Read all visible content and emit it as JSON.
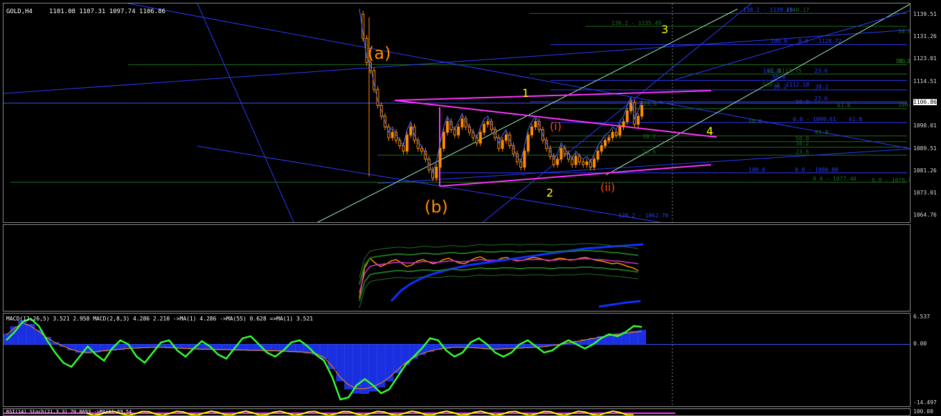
{
  "chart_data": [
    {
      "type": "line",
      "title": "GOLD,H4",
      "ohlc_header": "1101.08 1107.31 1097.74 1106.86",
      "ylim": [
        1062,
        1144
      ],
      "y_ticks": [
        "1139.51",
        "1131.26",
        "1123.01",
        "1114.51",
        "1106.86",
        "1098.01",
        "1089.51",
        "1081.26",
        "1073.01",
        "1064.76"
      ],
      "current_price": "1106.86",
      "colors": {
        "background": "#000000",
        "up_candle": "#ff8c00",
        "fib_green": "#1f6f1f",
        "fib_blue": "#2a3cff",
        "triangle": "#ff33ff",
        "channel": "#9ff0c0",
        "wave_major": "#ffff00",
        "wave_corrective": "#ff8c00",
        "wave_minor": "#ff4500"
      },
      "price_series": [
        1140,
        1131,
        1122,
        1119,
        1112,
        1106,
        1102,
        1098,
        1094,
        1096,
        1093,
        1091,
        1089,
        1095,
        1098,
        1093,
        1090,
        1089,
        1086,
        1082,
        1079,
        1083,
        1090,
        1096,
        1100,
        1097,
        1095,
        1098,
        1101,
        1098,
        1096,
        1094,
        1092,
        1096,
        1099,
        1100,
        1097,
        1094,
        1090,
        1093,
        1095,
        1091,
        1088,
        1085,
        1083,
        1089,
        1095,
        1098,
        1100,
        1097,
        1093,
        1090,
        1087,
        1084,
        1086,
        1090,
        1088,
        1086,
        1084,
        1087,
        1085,
        1084,
        1085,
        1083,
        1086,
        1089,
        1091,
        1093,
        1094,
        1096,
        1095,
        1098,
        1100,
        1104,
        1107,
        1099,
        1102,
        1106
      ],
      "wave_labels": [
        {
          "text": "(a)",
          "role": "corrective"
        },
        {
          "text": "(b)",
          "role": "corrective"
        },
        {
          "text": "1",
          "role": "major"
        },
        {
          "text": "2",
          "role": "major"
        },
        {
          "text": "3",
          "role": "major"
        },
        {
          "text": "4",
          "role": "major"
        },
        {
          "text": "(i)",
          "role": "minor"
        },
        {
          "text": "(ii)",
          "role": "minor"
        }
      ],
      "fib_labels": [
        {
          "text": "138.2 - 1139.49",
          "color": "#2a3cff",
          "price": 1140.3
        },
        {
          "text": "1140.17",
          "color": "#1f6f1f",
          "price": 1140.3
        },
        {
          "text": "138.2 - 1135.49",
          "color": "#1f6f1f",
          "price": 1135.5
        },
        {
          "text": "50.0",
          "color": "#1f6f1f",
          "price": 1132.5
        },
        {
          "text": "100.0",
          "color": "#2a3cff",
          "price": 1128.7
        },
        {
          "text": "0.0 - 1128.72",
          "color": "#2a3cff",
          "price": 1128.7
        },
        {
          "text": "100.0",
          "color": "#1f6f1f",
          "price": 1121.2
        },
        {
          "text": "38.2",
          "color": "#1f6f1f",
          "price": 1121.2
        },
        {
          "text": "161.8",
          "color": "#2a3cff",
          "price": 1117.7
        },
        {
          "text": "61.8",
          "color": "#1f6f1f",
          "price": 1117.7
        },
        {
          "text": "1117.75",
          "color": "#1f6f1f",
          "price": 1117.7
        },
        {
          "text": "23.6",
          "color": "#2a3cff",
          "price": 1117.7
        },
        {
          "text": "50.0",
          "color": "#2a3cff",
          "price": 1115.3
        },
        {
          "text": "138.2",
          "color": "#1f6f1f",
          "price": 1112.6
        },
        {
          "text": "1112.18",
          "color": "#2a3cff",
          "price": 1112.6
        },
        {
          "text": "38.2",
          "color": "#2a3cff",
          "price": 1111.8
        },
        {
          "text": "38.2",
          "color": "#2a3cff",
          "price": 1111.8
        },
        {
          "text": "23.6",
          "color": "#2a3cff",
          "price": 1107.4
        },
        {
          "text": "50.0",
          "color": "#2a3cff",
          "price": 1106.2
        },
        {
          "text": "61.8",
          "color": "#1f6f1f",
          "price": 1104.8
        },
        {
          "text": "100.0",
          "color": "#1f6f1f",
          "price": 1105.0
        },
        {
          "text": "23.6",
          "color": "#1f6f1f",
          "price": 1105.3
        },
        {
          "text": "0.0 - 1099.61",
          "color": "#2a3cff",
          "price": 1099.6
        },
        {
          "text": "61.8",
          "color": "#2a3cff",
          "price": 1099.6
        },
        {
          "text": "50.0",
          "color": "#1f6f1f",
          "price": 1098.9
        },
        {
          "text": "61.8",
          "color": "#1f6f1f",
          "price": 1094.7
        },
        {
          "text": "38.2",
          "color": "#1f6f1f",
          "price": 1093.2
        },
        {
          "text": "50.0",
          "color": "#1f6f1f",
          "price": 1092.5
        },
        {
          "text": "38.2",
          "color": "#1f6f1f",
          "price": 1090.5
        },
        {
          "text": "23.6",
          "color": "#1f6f1f",
          "price": 1087.5
        },
        {
          "text": "23.6",
          "color": "#1f6f1f",
          "price": 1087.5
        },
        {
          "text": "0.0 - 1080.88",
          "color": "#2a3cff",
          "price": 1080.9
        },
        {
          "text": "100.0",
          "color": "#2a3cff",
          "price": 1080.9
        },
        {
          "text": "0.0 - 1077.40",
          "color": "#1f6f1f",
          "price": 1077.4
        },
        {
          "text": "0.0 - 1076.88",
          "color": "#1f6f1f",
          "price": 1076.9
        },
        {
          "text": "138.2 - 1062.70",
          "color": "#2a3cff",
          "price": 1063.8
        }
      ]
    },
    {
      "type": "line",
      "title": "",
      "series": [
        {
          "values": [
            106,
            62,
            48,
            55,
            60,
            57,
            52,
            50,
            55,
            60,
            58,
            52,
            50,
            53,
            56,
            54,
            50,
            48,
            52,
            55,
            56,
            52,
            48,
            46,
            50,
            54,
            52,
            48,
            47,
            50,
            52,
            51,
            49,
            47,
            48,
            50,
            52,
            50,
            48,
            49,
            51,
            50,
            48,
            47,
            49,
            51,
            52,
            54,
            56,
            55,
            57,
            60,
            62,
            66
          ]
        },
        {
          "values": [
            98,
            70,
            60,
            58,
            57,
            56,
            55,
            54,
            54,
            55,
            55,
            54,
            53,
            53,
            54,
            54,
            53,
            52,
            52,
            53,
            53,
            52,
            51,
            50,
            51,
            51,
            51,
            50,
            50,
            50,
            51,
            51,
            50,
            50,
            50,
            50,
            51,
            51,
            50,
            50,
            50,
            50,
            49,
            49,
            49,
            50,
            50,
            51,
            52,
            52,
            53,
            54,
            55,
            56
          ]
        },
        {
          "values": [
            110,
            95,
            85,
            78,
            72,
            68,
            64,
            61,
            58,
            56,
            54,
            52,
            50,
            48,
            46,
            44,
            42,
            40,
            38,
            36,
            34,
            33,
            32,
            31,
            30,
            29,
            28
          ]
        },
        {
          "values": [
            118,
            115,
            112,
            110
          ]
        }
      ]
    },
    {
      "type": "line",
      "header": "MACD(12,26,5) 3.521 2.958  MACD(2,8,3) 4.286 2.210  ->MA(1) 4.286  ->MA(55) 0.628  =>MA(1) 3.521",
      "y_ticks": [
        "6.537",
        "0.00",
        "-14.497"
      ],
      "ylim": [
        -14.497,
        6.537
      ],
      "series": [
        {
          "values": [
            2.6,
            4.4,
            5.8,
            5.0,
            3.5,
            1.8,
            0.5,
            -0.5,
            -1.4,
            -2.0,
            -2.2,
            -2.0,
            -1.7,
            -1.5,
            -1.3,
            -1.1,
            -1.0,
            -0.9,
            -0.8,
            -0.8,
            -0.9,
            -1.0,
            -1.1,
            -1.2,
            -1.3,
            -1.3,
            -1.4,
            -1.4,
            -1.5,
            -1.5,
            -1.6,
            -1.6,
            -1.7,
            -1.7,
            -1.8,
            -1.9,
            -2.0,
            -2.2,
            -2.5,
            -3.5,
            -6.0,
            -9.0,
            -11.0,
            -12.0,
            -12.1,
            -11.5,
            -10.5,
            -9.0,
            -7.0,
            -5.0,
            -3.5,
            -2.5,
            -1.8,
            -1.3,
            -1.0,
            -0.8,
            -0.8,
            -0.9,
            -1.0,
            -1.2,
            -1.3,
            -1.2,
            -1.1,
            -1.0,
            -0.9,
            -0.8,
            -0.6,
            -0.3,
            0.0,
            0.4,
            0.8,
            1.2,
            1.6,
            2.0,
            2.4,
            2.7,
            3.0,
            3.3,
            3.521
          ]
        },
        {
          "values": [
            1.0,
            3.0,
            5.5,
            6.3,
            4.5,
            1.0,
            -2.0,
            -4.5,
            -5.5,
            -3.0,
            -0.5,
            -2.5,
            -4.0,
            -1.0,
            1.0,
            0.0,
            -3.0,
            -4.5,
            -2.0,
            0.5,
            1.0,
            -1.5,
            -3.0,
            -1.0,
            0.8,
            -0.5,
            -2.5,
            -3.5,
            -1.0,
            1.5,
            2.0,
            0.0,
            -2.0,
            -3.0,
            -1.5,
            0.5,
            1.0,
            -0.5,
            -2.5,
            -4.0,
            -8.0,
            -13.5,
            -13.0,
            -10.0,
            -8.5,
            -10.0,
            -12.0,
            -11.0,
            -8.0,
            -5.0,
            -3.0,
            -1.0,
            1.5,
            1.0,
            -1.5,
            -3.0,
            -2.0,
            0.5,
            1.5,
            0.0,
            -2.0,
            -3.0,
            -2.0,
            0.0,
            1.0,
            -0.5,
            -2.0,
            -1.5,
            0.0,
            1.0,
            0.0,
            -1.0,
            0.0,
            1.5,
            2.5,
            2.0,
            3.0,
            4.5,
            4.286
          ]
        }
      ]
    },
    {
      "type": "line",
      "header": "RSI(14)  Stoch(21,3,3) 70.8693  ->MA(1) 69.54",
      "y_ticks": [
        "100.00"
      ],
      "ylim": [
        0,
        100
      ]
    }
  ]
}
